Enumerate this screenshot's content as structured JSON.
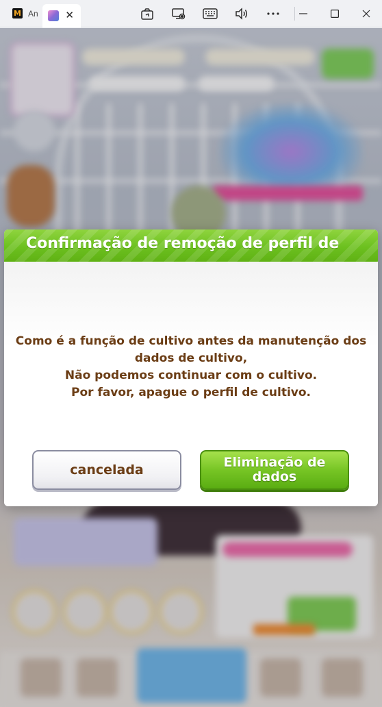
{
  "window": {
    "tabs": [
      {
        "label": "An",
        "active": false
      },
      {
        "label": "",
        "active": true
      }
    ],
    "toolbar_icons": [
      "screenshot-icon",
      "screen-record-icon",
      "keyboard-icon",
      "volume-icon",
      "more-icon"
    ],
    "window_controls": [
      "minimize-icon",
      "maximize-icon",
      "close-icon"
    ]
  },
  "dialog": {
    "title": "Confirmação de remoção de perfil de",
    "message_lines": [
      "Como é a função de cultivo antes da manutenção dos",
      "dados de cultivo,",
      "Não podemos continuar com o cultivo.",
      "Por favor, apague o perfil de cultivo."
    ],
    "cancel_label": "cancelada",
    "delete_label_line1": "Eliminação de",
    "delete_label_line2": "dados"
  },
  "colors": {
    "header_green": "#6cc01f",
    "message_brown": "#6b3d15",
    "cancel_border": "#8a8ca0",
    "delete_green": "#77c525"
  }
}
